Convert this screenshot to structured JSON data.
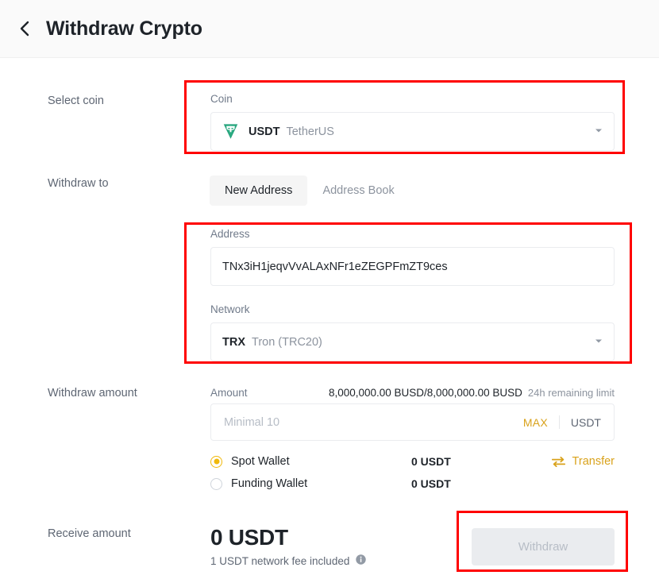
{
  "header": {
    "back_icon": "chevron-left-icon",
    "title": "Withdraw Crypto"
  },
  "sections": {
    "select_coin_label": "Select coin",
    "withdraw_to_label": "Withdraw to",
    "withdraw_amount_label": "Withdraw amount",
    "receive_amount_label": "Receive amount"
  },
  "coin": {
    "field_label": "Coin",
    "icon": "usdt-tether-icon",
    "symbol": "USDT",
    "name": "TetherUS",
    "caret": "▾"
  },
  "address_tabs": [
    {
      "label": "New Address",
      "active": true
    },
    {
      "label": "Address Book",
      "active": false
    }
  ],
  "address": {
    "field_label": "Address",
    "value": "TNx3iH1jeqvVvALAxNFr1eZEGPFmZT9ces"
  },
  "network": {
    "field_label": "Network",
    "symbol": "TRX",
    "name": "Tron (TRC20)",
    "caret": "▾"
  },
  "amount": {
    "field_label": "Amount",
    "limit_value": "8,000,000.00 BUSD/8,000,000.00 BUSD",
    "limit_caption": "24h remaining limit",
    "placeholder": "Minimal 10",
    "value": "",
    "max_label": "MAX",
    "unit": "USDT"
  },
  "wallets": [
    {
      "name": "Spot Wallet",
      "balance": "0 USDT",
      "selected": true
    },
    {
      "name": "Funding Wallet",
      "balance": "0 USDT",
      "selected": false
    }
  ],
  "transfer": {
    "icon": "transfer-arrows-icon",
    "label": "Transfer"
  },
  "receive": {
    "amount": "0 USDT",
    "fee_note": "1 USDT network fee included",
    "info_icon": "info-circle-icon"
  },
  "withdraw_button": {
    "label": "Withdraw",
    "disabled": true
  },
  "colors": {
    "accent": "#f0b90b",
    "accent_text": "#d9a21b",
    "annotation": "#ff0000",
    "text_primary": "#1e2329",
    "text_secondary": "#707a8a",
    "border": "#eaecef",
    "header_bg": "#fafafa"
  },
  "annotations": [
    {
      "name": "coin-selector-highlight"
    },
    {
      "name": "address-network-highlight"
    },
    {
      "name": "withdraw-button-highlight"
    }
  ]
}
